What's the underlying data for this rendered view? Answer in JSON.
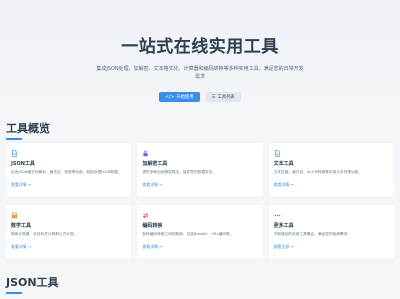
{
  "hero": {
    "title": "一站式在线实用工具",
    "description": "集成JSON处理、加解密、文本格式化、计算器和编码转换等多种实用工具，满足您的日常开发需求",
    "primary_button": "开始使用",
    "secondary_button": "工具列表"
  },
  "overview": {
    "title": "工具概览"
  },
  "cards": [
    {
      "title": "JSON工具",
      "desc": "包含JSON格式化解析、格式化、校验等功能，轻松处理JSON数据。",
      "link": "查看详情 →",
      "icon": "json-file-icon",
      "color": "#3a8ee6"
    },
    {
      "title": "加解密工具",
      "desc": "提供多种加密解密算法，保护您的数据安全。",
      "link": "查看详情 →",
      "icon": "lock-icon",
      "color": "#7b5fd6"
    },
    {
      "title": "文本工具",
      "desc": "文本压缩、格式化、大小写转换等实用文本处理功能。",
      "link": "查看详情 →",
      "icon": "text-file-icon",
      "color": "#3aa878"
    },
    {
      "title": "数学工具",
      "desc": "简单计算器、支持科学计算和公式计算。",
      "link": "查看详情 →",
      "icon": "calculator-icon",
      "color": "#e68a3a"
    },
    {
      "title": "编码转换",
      "desc": "各种编码转换之间的转换，包括Base64、URL编码等。",
      "link": "查看详情 →",
      "icon": "exchange-icon",
      "color": "#e0524e"
    },
    {
      "title": "更多工具",
      "desc": "不断增加的实用工具集合，满足您的各种需求。",
      "link": "查看全部 →",
      "icon": "more-dots-icon",
      "color": "#8a5fd6"
    }
  ],
  "json_section": {
    "title": "JSON工具"
  }
}
